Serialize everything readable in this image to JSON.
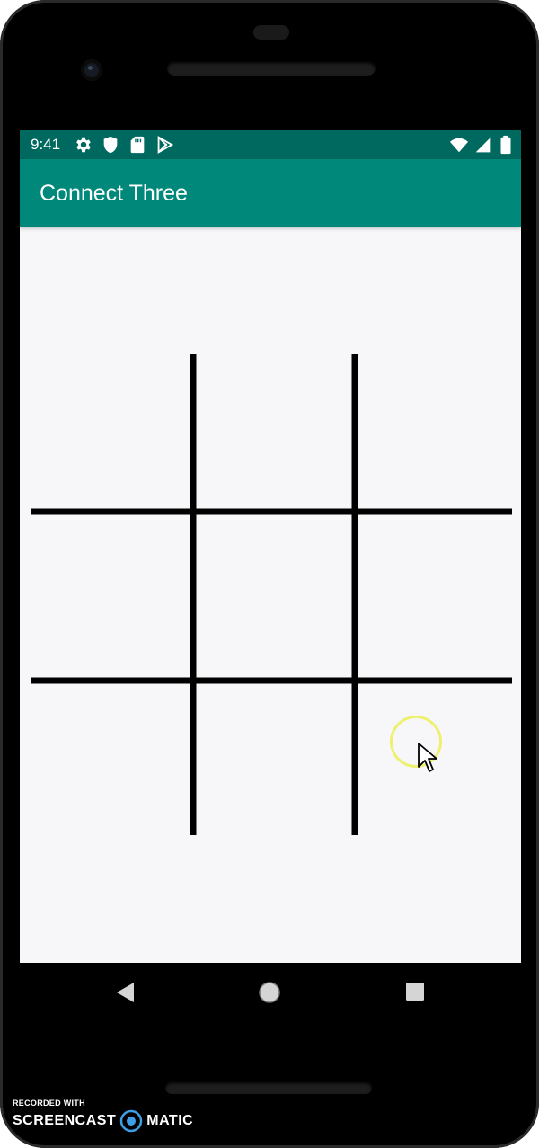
{
  "status_bar": {
    "time": "9:41",
    "left_icons": [
      "gear-icon",
      "shield-icon",
      "sd-card-icon",
      "play-store-icon"
    ],
    "right_icons": [
      "wifi-icon",
      "signal-icon",
      "battery-icon"
    ]
  },
  "app_bar": {
    "title": "Connect Three",
    "color": "#00897b",
    "status_color": "#00695f"
  },
  "board": {
    "rows": 3,
    "columns": 3,
    "cells": [
      "",
      "",
      "",
      "",
      "",
      "",
      "",
      "",
      ""
    ],
    "line_color": "#000000"
  },
  "nav_bar": {
    "buttons": [
      "back-icon",
      "home-icon",
      "recents-icon"
    ]
  },
  "watermark": {
    "line1": "RECORDED WITH",
    "brand_left": "SCREENCAST",
    "brand_right": "MATIC"
  }
}
